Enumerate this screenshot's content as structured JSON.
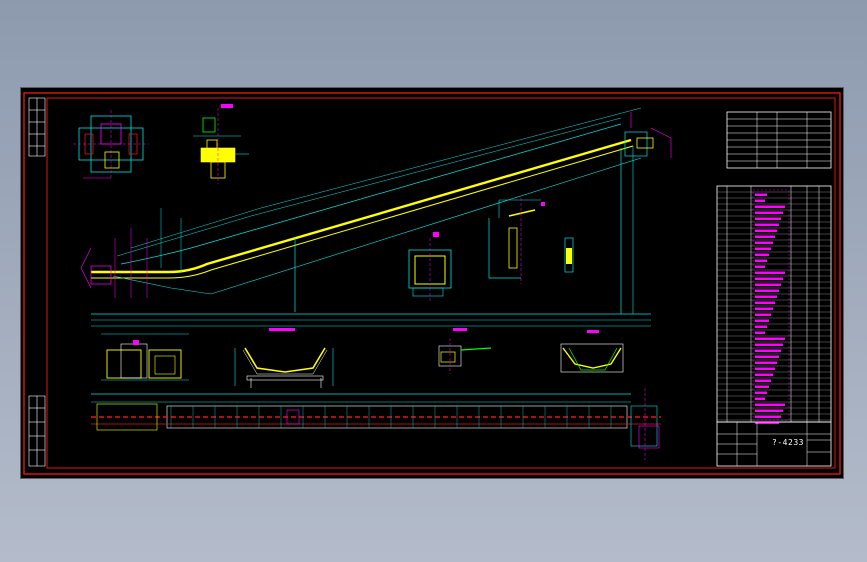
{
  "drawing": {
    "title_block_code": "?-4233",
    "colors": {
      "background": "#000000",
      "frame": "#e0161a",
      "conveyor": "#ffff00",
      "dimension": "#00e5e5",
      "text": "#ff00ff",
      "table_lines": "#ffffff",
      "hatch": "#e0161a",
      "detail": "#00ff00"
    }
  }
}
